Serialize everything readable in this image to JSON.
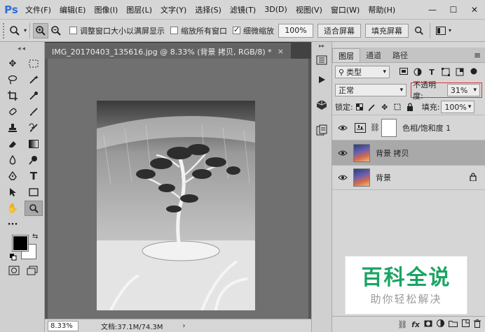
{
  "app": {
    "logo": "Ps"
  },
  "menu": [
    "文件(F)",
    "编辑(E)",
    "图像(I)",
    "图层(L)",
    "文字(Y)",
    "选择(S)",
    "滤镜(T)",
    "3D(D)",
    "视图(V)",
    "窗口(W)",
    "帮助(H)"
  ],
  "window_controls": {
    "minimize": "—",
    "maximize": "☐",
    "close": "✕"
  },
  "options": {
    "resize_window_label": "调整窗口大小以满屏显示",
    "zoom_all_label": "缩放所有窗口",
    "scrubby_zoom_label": "细微缩放",
    "zoom_value": "100%",
    "fit_screen_label": "适合屏幕",
    "fill_screen_label": "填充屏幕"
  },
  "document": {
    "tab_title": "IMG_20170403_135616.jpg @ 8.33% (背景 拷贝, RGB/8) *",
    "close_glyph": "×",
    "zoom": "8.33%",
    "doc_info": "文档:37.1M/74.3M",
    "status_arrow": "›"
  },
  "layers_panel": {
    "tabs": [
      "图层",
      "通道",
      "路径"
    ],
    "menu_glyph": "≡",
    "filter_kind": "类型",
    "blend_mode": "正常",
    "opacity_label": "不透明度:",
    "opacity_value": "31%",
    "lock_label": "锁定:",
    "fill_label": "填充:",
    "fill_value": "100%",
    "layers": [
      {
        "name": "色相/饱和度 1",
        "type": "adjustment",
        "visible": true,
        "selected": false
      },
      {
        "name": "背景 拷贝",
        "type": "image",
        "visible": true,
        "selected": true
      },
      {
        "name": "背景",
        "type": "image",
        "visible": true,
        "selected": false,
        "locked": true
      }
    ],
    "footer_icons": [
      "link-icon",
      "fx-icon",
      "mask-icon",
      "adjustment-icon",
      "folder-icon",
      "new-layer-icon",
      "trash-icon"
    ],
    "fx_label": "fx"
  },
  "watermark": {
    "title": "百科全说",
    "subtitle": "助你轻松解决"
  },
  "colors": {
    "accent_green": "#1aa463",
    "highlight_red": "#e03030",
    "foreground": "#000000",
    "background": "#ffffff"
  }
}
